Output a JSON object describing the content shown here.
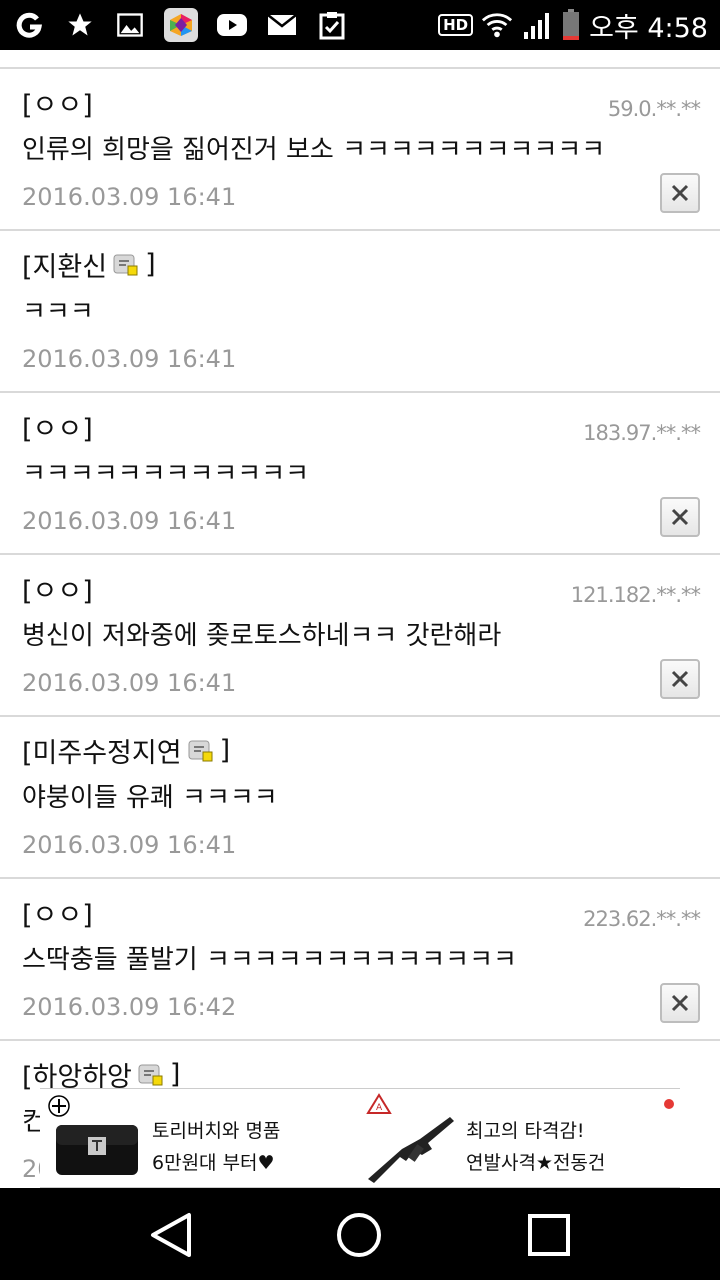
{
  "status_bar": {
    "hd_label": "HD",
    "time": "오후 4:58",
    "icons": [
      "g-app-icon",
      "star-icon",
      "gallery-icon",
      "app-store-icon",
      "youtube-icon",
      "mail-icon",
      "clipboard-check-icon",
      "wifi-icon",
      "signal-icon",
      "battery-icon"
    ]
  },
  "comments": [
    {
      "author": "[ㅇㅇ]",
      "member_icon": false,
      "ip": "59.0.**.**",
      "text": "인류의 희망을 짊어진거 보소 ㅋㅋㅋㅋㅋㅋㅋㅋㅋㅋㅋ",
      "date": "2016.03.09 16:41",
      "deletable": true
    },
    {
      "author_name": "[지환신",
      "author_close": "]",
      "member_icon": true,
      "text": "ㅋㅋㅋ",
      "date": "2016.03.09 16:41",
      "deletable": false
    },
    {
      "author": "[ㅇㅇ]",
      "member_icon": false,
      "ip": "183.97.**.**",
      "text": "ㅋㅋㅋㅋㅋㅋㅋㅋㅋㅋㅋㅋ",
      "date": "2016.03.09 16:41",
      "deletable": true
    },
    {
      "author": "[ㅇㅇ]",
      "member_icon": false,
      "ip": "121.182.**.**",
      "text": "병신이 저와중에 좆로토스하네ㅋㅋ 갓란해라",
      "date": "2016.03.09 16:41",
      "deletable": true
    },
    {
      "author_name": "[미주수정지연",
      "author_close": "]",
      "member_icon": true,
      "text": "야붕이들 유쾌 ㅋㅋㅋㅋ",
      "date": "2016.03.09 16:41",
      "deletable": false
    },
    {
      "author": "[ㅇㅇ]",
      "member_icon": false,
      "ip": "223.62.**.**",
      "text": "스딱충들 풀발기 ㅋㅋㅋㅋㅋㅋㅋㅋㅋㅋㅋㅋㅋ",
      "date": "2016.03.09 16:42",
      "deletable": true
    },
    {
      "author_name": "[하앙하앙",
      "author_close": "]",
      "member_icon": true,
      "text": "컨",
      "date": "20",
      "deletable": false
    }
  ],
  "ad_banner": {
    "items": [
      {
        "line1": "토리버치와 명품",
        "line2": "6만원대 부터♥"
      },
      {
        "line1": "최고의 타격감!",
        "line2": "연발사격★전동건"
      }
    ],
    "accent": "#e53935"
  },
  "nav_bar": {
    "icons": [
      "back-icon",
      "home-icon",
      "recents-icon"
    ]
  }
}
